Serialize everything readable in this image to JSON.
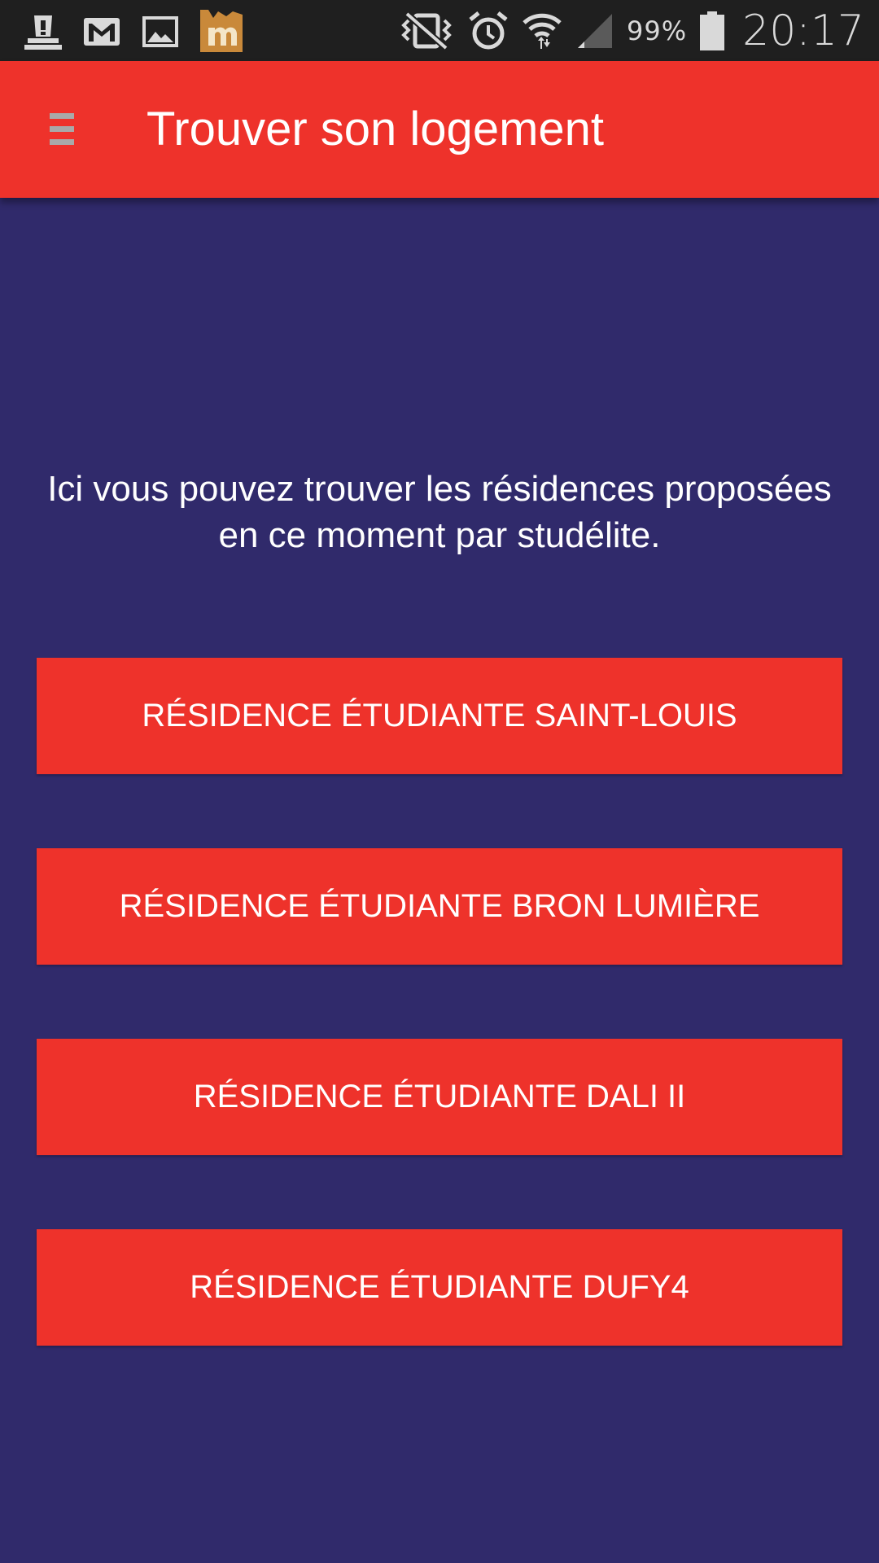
{
  "status_bar": {
    "left_icons": [
      "notification-alert-icon",
      "gmail-icon",
      "gallery-icon",
      "m-app-icon"
    ],
    "right_icons": [
      "vibrate-icon",
      "alarm-icon",
      "wifi-icon",
      "signal-icon",
      "battery-icon"
    ],
    "battery_percent": "99%",
    "time": "20:17"
  },
  "app_bar": {
    "menu_icon": "hamburger-menu-icon",
    "title": "Trouver son logement",
    "background": "#ee322b"
  },
  "main": {
    "background": "#302a6b",
    "intro_line1": "Ici vous pouvez trouver les résidences proposées",
    "intro_line2": "en ce moment par studélite.",
    "residences": [
      "RÉSIDENCE ÉTUDIANTE SAINT-LOUIS",
      "RÉSIDENCE ÉTUDIANTE BRON LUMIÈRE",
      "RÉSIDENCE ÉTUDIANTE DALI II",
      "RÉSIDENCE ÉTUDIANTE DUFY4"
    ]
  }
}
